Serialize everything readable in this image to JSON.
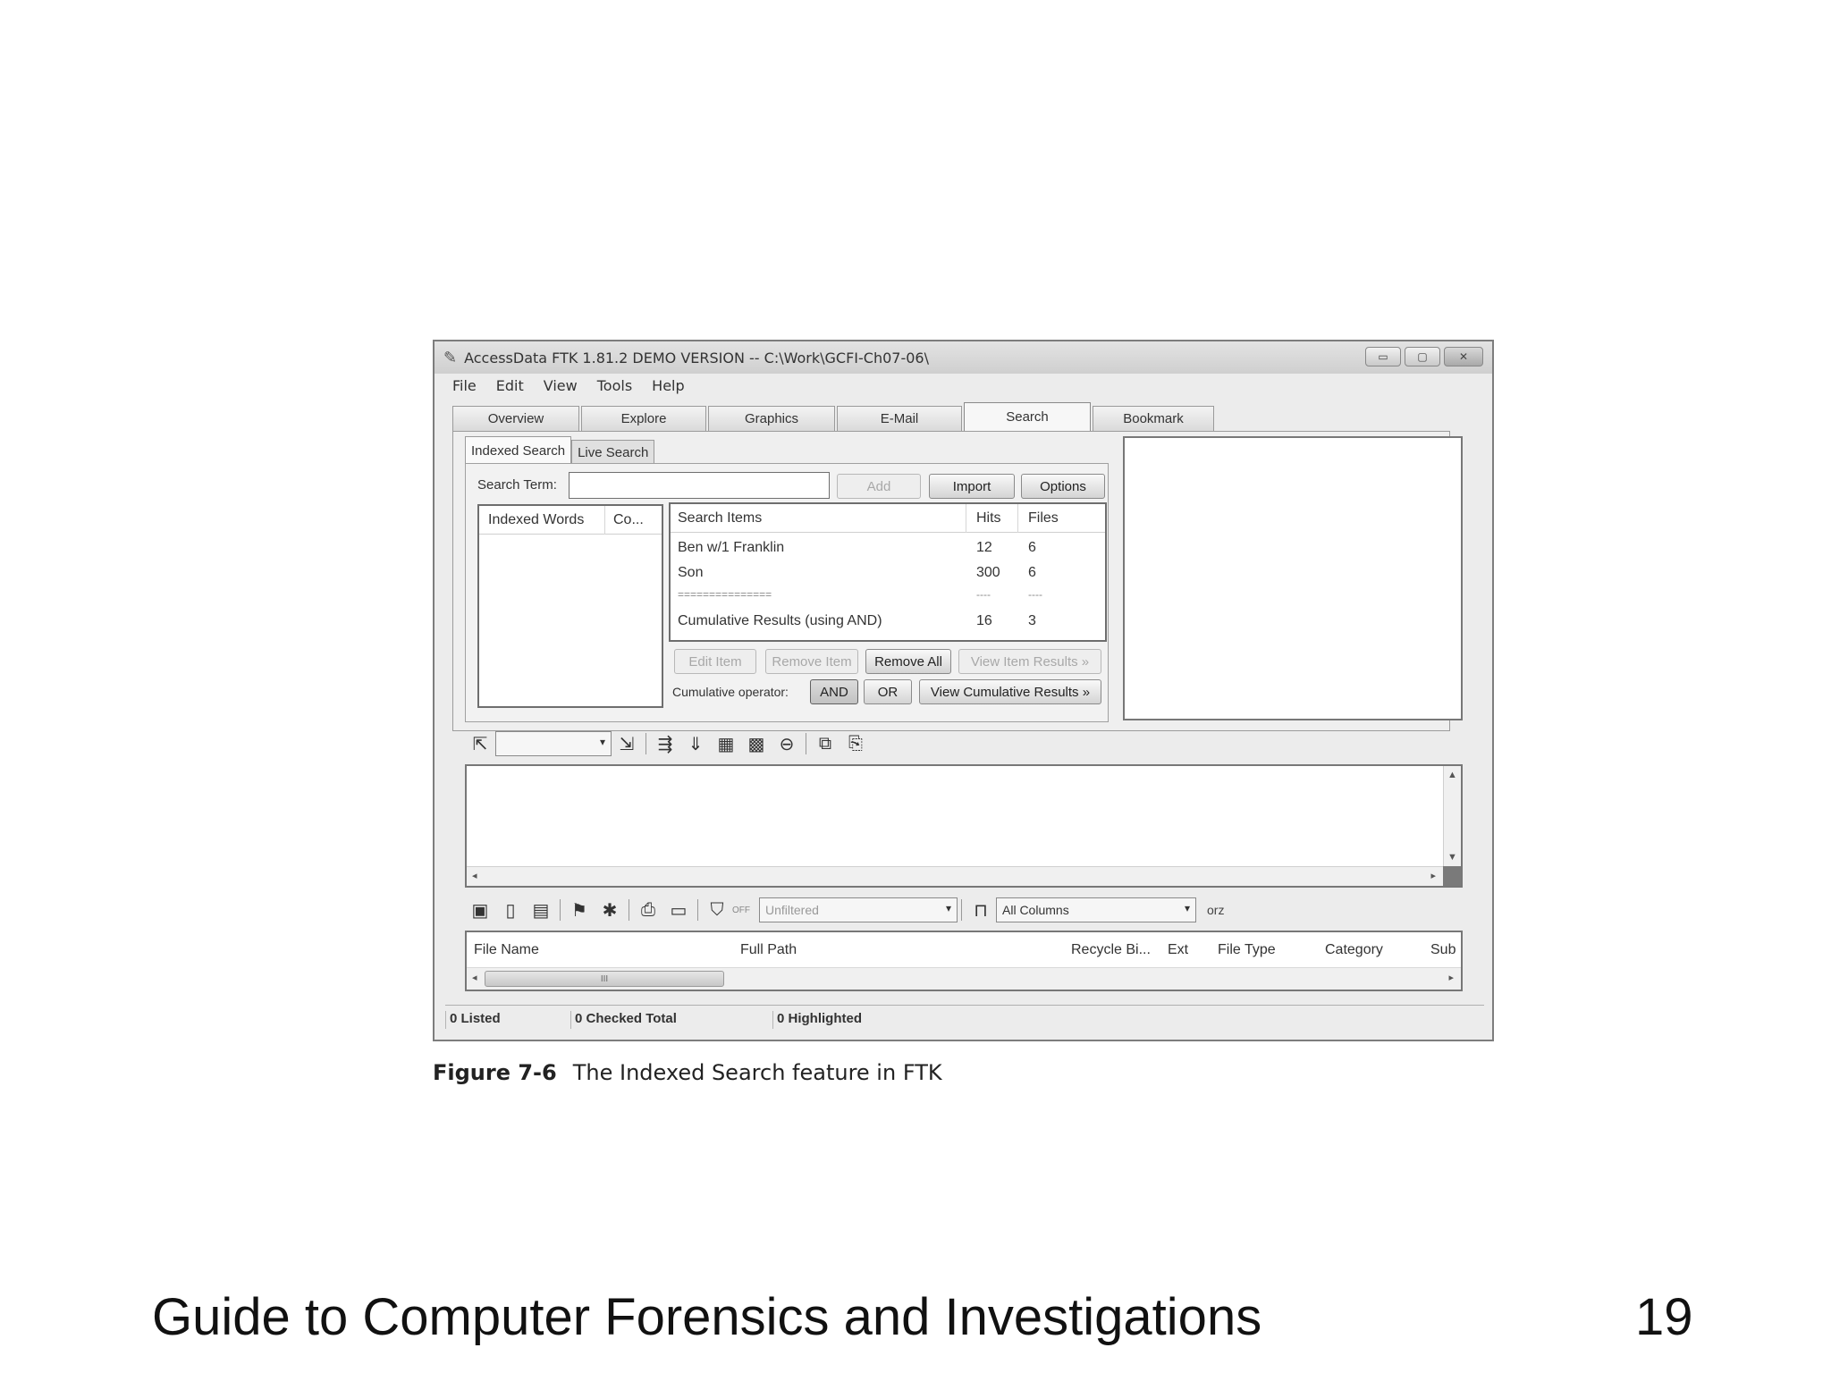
{
  "window": {
    "title": "AccessData FTK 1.81.2 DEMO VERSION -- C:\\Work\\GCFI-Ch07-06\\",
    "app_icon": "pen-icon",
    "controls": {
      "minimize": "▭",
      "maximize": "▢",
      "close": "✕"
    }
  },
  "menu": {
    "items": [
      "File",
      "Edit",
      "View",
      "Tools",
      "Help"
    ]
  },
  "main_tabs": [
    "Overview",
    "Explore",
    "Graphics",
    "E-Mail",
    "Search",
    "Bookmark"
  ],
  "active_main_tab": "Search",
  "sub_tabs": [
    "Indexed Search",
    "Live Search"
  ],
  "search": {
    "term_label": "Search Term:",
    "term_value": "",
    "add_label": "Add",
    "import_label": "Import",
    "options_label": "Options"
  },
  "indexed_words": {
    "columns": [
      "Indexed Words",
      "Co..."
    ]
  },
  "search_items": {
    "columns": [
      "Search Items",
      "Hits",
      "Files"
    ],
    "rows": [
      [
        "Ben w/1 Franklin",
        "12",
        "6"
      ],
      [
        "Son",
        "300",
        "6"
      ],
      [
        "===============",
        "----",
        "----"
      ],
      [
        "Cumulative Results (using AND)",
        "16",
        "3"
      ]
    ],
    "edit_item": "Edit Item",
    "remove_item": "Remove Item",
    "remove_all": "Remove All",
    "view_item_results": "View Item Results »",
    "cumulative_operator_label": "Cumulative operator:",
    "and_label": "AND",
    "or_label": "OR",
    "view_cumulative_results": "View Cumulative Results »"
  },
  "filter": {
    "unfiltered": "Unfiltered",
    "off_label": "OFF",
    "all_columns": "All Columns",
    "extra": "orz"
  },
  "file_list": {
    "columns": [
      "File Name",
      "Full Path",
      "Recycle Bi...",
      "Ext",
      "File Type",
      "Category",
      "Sub"
    ],
    "scroll_thumb": "III"
  },
  "status": {
    "listed": "0 Listed",
    "checked_total": "0 Checked Total",
    "highlighted": "0 Highlighted"
  },
  "caption": {
    "label": "Figure 7-6",
    "text": "The Indexed Search feature in FTK"
  },
  "footer": {
    "title": "Guide to Computer Forensics and Investigations",
    "page": "19"
  }
}
